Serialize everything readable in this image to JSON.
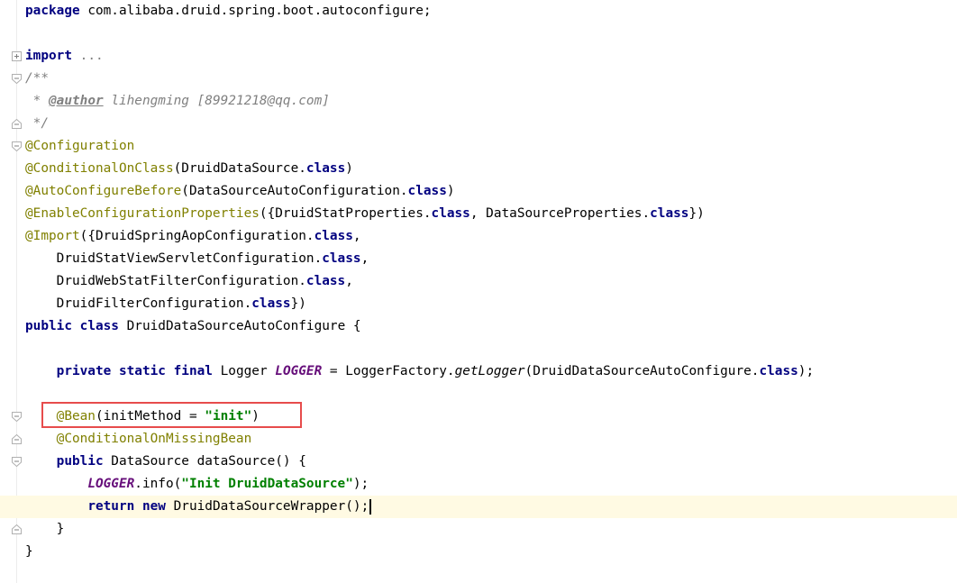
{
  "editor": {
    "lines": [
      {
        "tokens": [
          {
            "t": "package",
            "c": "kw"
          },
          {
            "t": " com.alibaba.druid.spring.boot.autoconfigure;",
            "c": ""
          }
        ]
      },
      {
        "tokens": []
      },
      {
        "tokens": [
          {
            "t": "import",
            "c": "kw"
          },
          {
            "t": " ",
            "c": ""
          },
          {
            "t": "...",
            "c": "fold"
          }
        ],
        "fold": "plus"
      },
      {
        "tokens": [
          {
            "t": "/**",
            "c": "com"
          }
        ],
        "fold": "open"
      },
      {
        "tokens": [
          {
            "t": " * ",
            "c": "com"
          },
          {
            "t": "@author",
            "c": "tag"
          },
          {
            "t": " lihengming [89921218@qq.com]",
            "c": "com"
          }
        ]
      },
      {
        "tokens": [
          {
            "t": " */",
            "c": "com"
          }
        ],
        "fold": "close"
      },
      {
        "tokens": [
          {
            "t": "@Configuration",
            "c": "ann"
          }
        ],
        "fold": "open"
      },
      {
        "tokens": [
          {
            "t": "@ConditionalOnClass",
            "c": "ann"
          },
          {
            "t": "(DruidDataSource.",
            "c": ""
          },
          {
            "t": "class",
            "c": "kw"
          },
          {
            "t": ")",
            "c": ""
          }
        ]
      },
      {
        "tokens": [
          {
            "t": "@AutoConfigureBefore",
            "c": "ann"
          },
          {
            "t": "(DataSourceAutoConfiguration.",
            "c": ""
          },
          {
            "t": "class",
            "c": "kw"
          },
          {
            "t": ")",
            "c": ""
          }
        ]
      },
      {
        "tokens": [
          {
            "t": "@EnableConfigurationProperties",
            "c": "ann"
          },
          {
            "t": "({DruidStatProperties.",
            "c": ""
          },
          {
            "t": "class",
            "c": "kw"
          },
          {
            "t": ", DataSourceProperties.",
            "c": ""
          },
          {
            "t": "class",
            "c": "kw"
          },
          {
            "t": "})",
            "c": ""
          }
        ]
      },
      {
        "tokens": [
          {
            "t": "@Import",
            "c": "ann"
          },
          {
            "t": "({DruidSpringAopConfiguration.",
            "c": ""
          },
          {
            "t": "class",
            "c": "kw"
          },
          {
            "t": ",",
            "c": ""
          }
        ]
      },
      {
        "tokens": [
          {
            "t": "    DruidStatViewServletConfiguration.",
            "c": ""
          },
          {
            "t": "class",
            "c": "kw"
          },
          {
            "t": ",",
            "c": ""
          }
        ]
      },
      {
        "tokens": [
          {
            "t": "    DruidWebStatFilterConfiguration.",
            "c": ""
          },
          {
            "t": "class",
            "c": "kw"
          },
          {
            "t": ",",
            "c": ""
          }
        ]
      },
      {
        "tokens": [
          {
            "t": "    DruidFilterConfiguration.",
            "c": ""
          },
          {
            "t": "class",
            "c": "kw"
          },
          {
            "t": "})",
            "c": ""
          }
        ]
      },
      {
        "tokens": [
          {
            "t": "public",
            "c": "kw"
          },
          {
            "t": " ",
            "c": ""
          },
          {
            "t": "class",
            "c": "kw"
          },
          {
            "t": " DruidDataSourceAutoConfigure {",
            "c": ""
          }
        ]
      },
      {
        "tokens": []
      },
      {
        "tokens": [
          {
            "t": "    ",
            "c": ""
          },
          {
            "t": "private",
            "c": "kw"
          },
          {
            "t": " ",
            "c": ""
          },
          {
            "t": "static",
            "c": "kw"
          },
          {
            "t": " ",
            "c": ""
          },
          {
            "t": "final",
            "c": "kw"
          },
          {
            "t": " Logger ",
            "c": ""
          },
          {
            "t": "LOGGER",
            "c": "fld"
          },
          {
            "t": " = LoggerFactory.",
            "c": ""
          },
          {
            "t": "getLogger",
            "c": "method-it"
          },
          {
            "t": "(DruidDataSourceAutoConfigure.",
            "c": ""
          },
          {
            "t": "class",
            "c": "kw"
          },
          {
            "t": ");",
            "c": ""
          }
        ]
      },
      {
        "tokens": []
      },
      {
        "tokens": [
          {
            "t": "    ",
            "c": ""
          },
          {
            "t": "@Bean",
            "c": "ann"
          },
          {
            "t": "(initMethod = ",
            "c": ""
          },
          {
            "t": "\"init\"",
            "c": "str"
          },
          {
            "t": ")",
            "c": ""
          }
        ],
        "fold": "open"
      },
      {
        "tokens": [
          {
            "t": "    ",
            "c": ""
          },
          {
            "t": "@ConditionalOnMissingBean",
            "c": "ann"
          }
        ],
        "fold": "close"
      },
      {
        "tokens": [
          {
            "t": "    ",
            "c": ""
          },
          {
            "t": "public",
            "c": "kw"
          },
          {
            "t": " DataSource dataSource() {",
            "c": ""
          }
        ],
        "fold": "open"
      },
      {
        "tokens": [
          {
            "t": "        ",
            "c": ""
          },
          {
            "t": "LOGGER",
            "c": "fld"
          },
          {
            "t": ".info(",
            "c": ""
          },
          {
            "t": "\"Init DruidDataSource\"",
            "c": "str"
          },
          {
            "t": ");",
            "c": ""
          }
        ]
      },
      {
        "tokens": [
          {
            "t": "        ",
            "c": ""
          },
          {
            "t": "return",
            "c": "kw"
          },
          {
            "t": " ",
            "c": ""
          },
          {
            "t": "new",
            "c": "kw"
          },
          {
            "t": " DruidDataSourceWrapper();",
            "c": ""
          }
        ],
        "current": true,
        "caret": true
      },
      {
        "tokens": [
          {
            "t": "    }",
            "c": ""
          }
        ],
        "fold": "close"
      },
      {
        "tokens": [
          {
            "t": "}",
            "c": ""
          }
        ]
      }
    ],
    "highlighted_line": "@Bean(initMethod = \"init\")"
  }
}
